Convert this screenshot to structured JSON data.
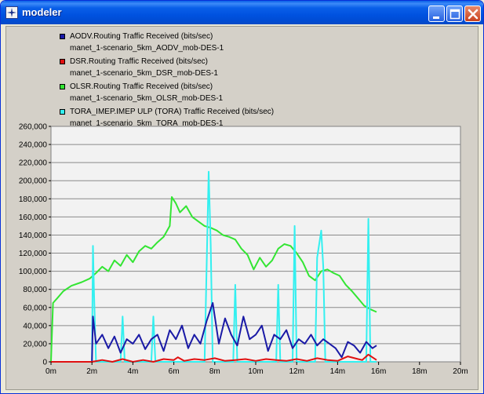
{
  "window": {
    "title": "modeler",
    "buttons": {
      "minimize": "minimize",
      "maximize": "maximize",
      "close": "close"
    }
  },
  "legend": [
    {
      "title": "AODV.Routing Traffic Received (bits/sec)",
      "subtitle": "manet_1-scenario_5km_AODV_mob-DES-1",
      "color": "#1a1aa6"
    },
    {
      "title": "DSR.Routing Traffic Received (bits/sec)",
      "subtitle": "manet_1-scenario_5km_DSR_mob-DES-1",
      "color": "#e01010"
    },
    {
      "title": "OLSR.Routing Traffic Received (bits/sec)",
      "subtitle": "manet_1-scenario_5km_OLSR_mob-DES-1",
      "color": "#33e533"
    },
    {
      "title": "TORA_IMEP.IMEP ULP (TORA) Traffic Received (bits/sec)",
      "subtitle": "manet_1-scenario_5km_TORA_mob-DES-1",
      "color": "#33f0f0"
    }
  ],
  "chart_data": {
    "type": "line",
    "title": "",
    "xlabel": "",
    "ylabel": "",
    "xlim": [
      0,
      20
    ],
    "ylim": [
      0,
      260000
    ],
    "x_ticks": [
      "0m",
      "2m",
      "4m",
      "6m",
      "8m",
      "10m",
      "12m",
      "14m",
      "16m",
      "18m",
      "20m"
    ],
    "y_ticks": [
      "0",
      "20,000",
      "40,000",
      "60,000",
      "80,000",
      "100,000",
      "120,000",
      "140,000",
      "160,000",
      "180,000",
      "200,000",
      "220,000",
      "240,000",
      "260,000"
    ],
    "grid": true,
    "series": [
      {
        "name": "OLSR.Routing Traffic Received (bits/sec)",
        "color": "#33e533",
        "x": [
          0,
          0.1,
          0.3,
          0.6,
          1.0,
          1.5,
          1.9,
          2.2,
          2.5,
          2.8,
          3.1,
          3.4,
          3.7,
          4.0,
          4.3,
          4.6,
          4.9,
          5.2,
          5.5,
          5.8,
          5.9,
          6.1,
          6.3,
          6.6,
          6.9,
          7.2,
          7.5,
          7.8,
          8.1,
          8.4,
          8.7,
          9.0,
          9.3,
          9.6,
          9.9,
          10.2,
          10.5,
          10.8,
          11.1,
          11.4,
          11.7,
          12.0,
          12.3,
          12.6,
          12.9,
          13.2,
          13.5,
          13.8,
          14.1,
          14.4,
          14.7,
          15.0,
          15.3,
          15.6,
          15.9
        ],
        "values": [
          0,
          65000,
          70000,
          78000,
          84000,
          88000,
          92000,
          98000,
          105000,
          100000,
          112000,
          106000,
          118000,
          110000,
          122000,
          128000,
          125000,
          132000,
          138000,
          150000,
          182000,
          175000,
          165000,
          172000,
          160000,
          155000,
          150000,
          148000,
          145000,
          140000,
          138000,
          135000,
          125000,
          118000,
          102000,
          115000,
          105000,
          112000,
          125000,
          130000,
          128000,
          120000,
          110000,
          95000,
          90000,
          100000,
          102000,
          98000,
          95000,
          85000,
          78000,
          70000,
          62000,
          58000,
          55000
        ]
      },
      {
        "name": "TORA_IMEP.IMEP ULP (TORA) Traffic Received (bits/sec)",
        "color": "#33f0f0",
        "x": [
          0,
          1.9,
          2.0,
          2.05,
          2.1,
          2.2,
          2.3,
          2.5,
          3.0,
          3.4,
          3.5,
          3.6,
          4.0,
          4.9,
          5.0,
          5.1,
          5.3,
          5.5,
          5.8,
          6.0,
          6.5,
          7.0,
          7.5,
          7.7,
          7.8,
          7.9,
          8.3,
          8.9,
          9.0,
          9.1,
          9.5,
          10.0,
          10.5,
          11.0,
          11.1,
          11.2,
          11.8,
          11.9,
          12.0,
          12.8,
          12.9,
          13.0,
          13.2,
          13.3,
          13.4,
          14.0,
          14.5,
          15.0,
          15.4,
          15.5,
          15.6,
          15.9
        ],
        "values": [
          0,
          0,
          0,
          128000,
          78000,
          0,
          0,
          0,
          0,
          0,
          50000,
          0,
          0,
          0,
          50000,
          0,
          0,
          0,
          0,
          0,
          0,
          0,
          0,
          210000,
          130000,
          0,
          0,
          0,
          85000,
          0,
          0,
          0,
          0,
          0,
          85000,
          0,
          0,
          150000,
          0,
          0,
          0,
          115000,
          145000,
          105000,
          0,
          0,
          0,
          0,
          0,
          158000,
          0,
          0
        ]
      },
      {
        "name": "AODV.Routing Traffic Received (bits/sec)",
        "color": "#1a1aa6",
        "x": [
          0,
          1.9,
          2.0,
          2.05,
          2.2,
          2.5,
          2.8,
          3.1,
          3.4,
          3.7,
          4.0,
          4.3,
          4.6,
          4.9,
          5.2,
          5.5,
          5.8,
          6.1,
          6.4,
          6.7,
          7.0,
          7.3,
          7.6,
          7.9,
          8.2,
          8.5,
          8.8,
          9.1,
          9.4,
          9.7,
          10.0,
          10.3,
          10.6,
          10.9,
          11.2,
          11.5,
          11.8,
          12.1,
          12.4,
          12.7,
          13.0,
          13.3,
          13.6,
          13.9,
          14.2,
          14.5,
          14.8,
          15.1,
          15.4,
          15.7,
          15.9
        ],
        "values": [
          0,
          0,
          0,
          50000,
          20000,
          30000,
          15000,
          28000,
          10000,
          25000,
          20000,
          30000,
          14000,
          25000,
          30000,
          12000,
          35000,
          25000,
          40000,
          15000,
          30000,
          20000,
          45000,
          65000,
          20000,
          48000,
          30000,
          18000,
          50000,
          25000,
          30000,
          40000,
          12000,
          30000,
          25000,
          35000,
          15000,
          25000,
          20000,
          30000,
          18000,
          25000,
          20000,
          15000,
          5000,
          22000,
          18000,
          10000,
          22000,
          15000,
          18000
        ]
      },
      {
        "name": "DSR.Routing Traffic Received (bits/sec)",
        "color": "#e01010",
        "x": [
          0,
          2.0,
          2.5,
          3.0,
          3.5,
          4.0,
          4.5,
          5.0,
          5.5,
          6.0,
          6.2,
          6.5,
          7.0,
          7.5,
          8.0,
          8.5,
          9.0,
          9.5,
          10.0,
          10.5,
          11.0,
          11.5,
          12.0,
          12.5,
          13.0,
          13.5,
          14.0,
          14.5,
          15.0,
          15.2,
          15.5,
          15.9
        ],
        "values": [
          0,
          0,
          2000,
          0,
          3000,
          0,
          2000,
          0,
          3000,
          2000,
          5000,
          1000,
          3000,
          2000,
          4000,
          1000,
          2000,
          3000,
          1000,
          3000,
          2000,
          1000,
          3000,
          1000,
          4000,
          2000,
          1000,
          6000,
          3000,
          2000,
          8000,
          2000
        ]
      }
    ]
  }
}
